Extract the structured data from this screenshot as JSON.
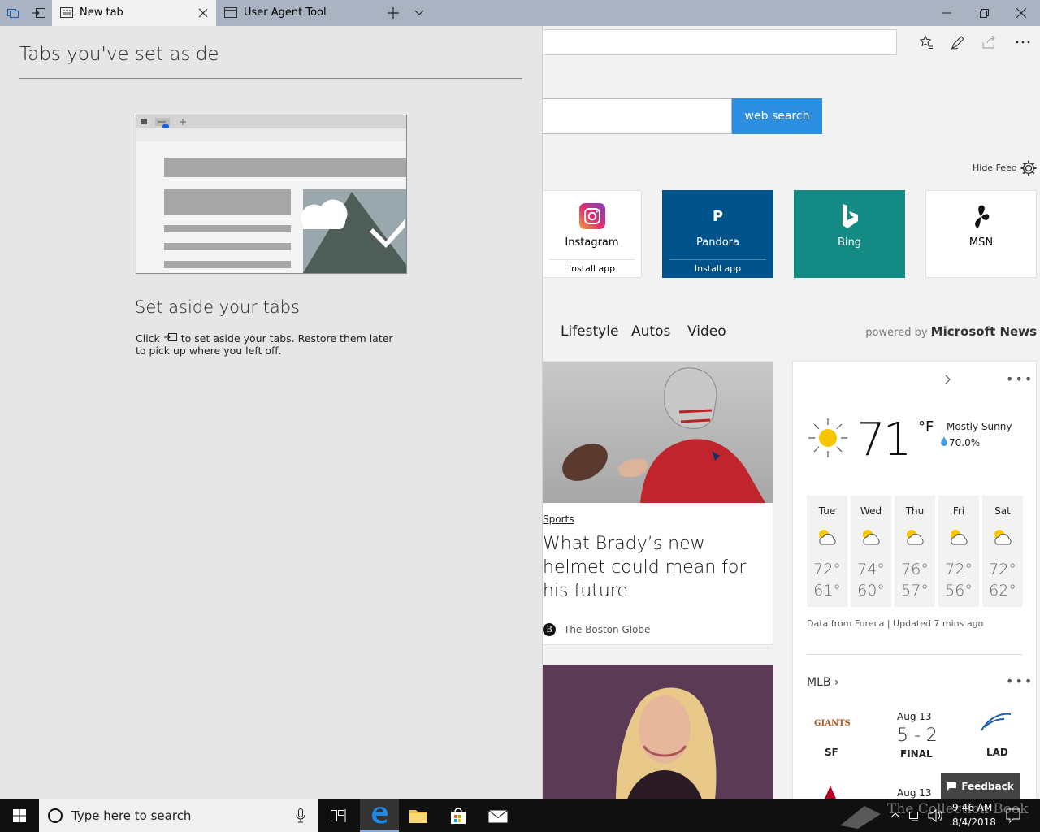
{
  "tabs": [
    {
      "label": "New tab",
      "active": true
    },
    {
      "label": "User Agent Tool",
      "active": false
    }
  ],
  "toolbar": {
    "icons": [
      "favorites-icon",
      "pen-icon",
      "share-icon",
      "more-icon"
    ]
  },
  "search": {
    "button_label": "web search"
  },
  "feed": {
    "hide_label": "Hide Feed"
  },
  "top_sites": [
    {
      "name": "Instagram",
      "sub": "Install app"
    },
    {
      "name": "Pandora",
      "sub": "Install app",
      "icon_letter": "P"
    },
    {
      "name": "Bing"
    },
    {
      "name": "MSN"
    }
  ],
  "news_tabs": [
    "Lifestyle",
    "Autos",
    "Video"
  ],
  "powered_by": {
    "prefix": "powered by",
    "brand": "Microsoft News"
  },
  "news": {
    "category": "Sports",
    "headline": "What Brady’s new helmet could mean for his future",
    "source": "The Boston Globe",
    "source_logo": "B"
  },
  "weather": {
    "temp": "71",
    "unit": "°F",
    "condition": "Mostly Sunny",
    "precip": "70.0%",
    "forecast": [
      {
        "day": "Tue",
        "hi": "72°",
        "lo": "61°"
      },
      {
        "day": "Wed",
        "hi": "74°",
        "lo": "60°"
      },
      {
        "day": "Thu",
        "hi": "76°",
        "lo": "57°"
      },
      {
        "day": "Fri",
        "hi": "72°",
        "lo": "56°"
      },
      {
        "day": "Sat",
        "hi": "72°",
        "lo": "62°"
      }
    ],
    "source": "Data from Foreca | Updated 7 mins ago"
  },
  "mlb": {
    "label": "MLB",
    "game": {
      "date": "Aug 13",
      "score": "5 - 2",
      "status": "FINAL",
      "home": "SF",
      "away": "LAD",
      "home_logo": "GIANTS"
    },
    "next_date": "Aug 13"
  },
  "feedback": {
    "label": "Feedback"
  },
  "panel": {
    "title": "Tabs you've set aside",
    "heading": "Set aside your tabs",
    "text_before": "Click",
    "text_after": "to set aside your tabs. Restore them later to pick up where you left off."
  },
  "taskbar": {
    "search_placeholder": "Type here to search",
    "time": "9:46 AM",
    "date": "8/4/2018",
    "watermark": "The Collection Book"
  },
  "colors": {
    "accent": "#2b8ee0",
    "pandora": "#00538a",
    "bing": "#138a84",
    "tabbar": "#a9b3c1"
  }
}
